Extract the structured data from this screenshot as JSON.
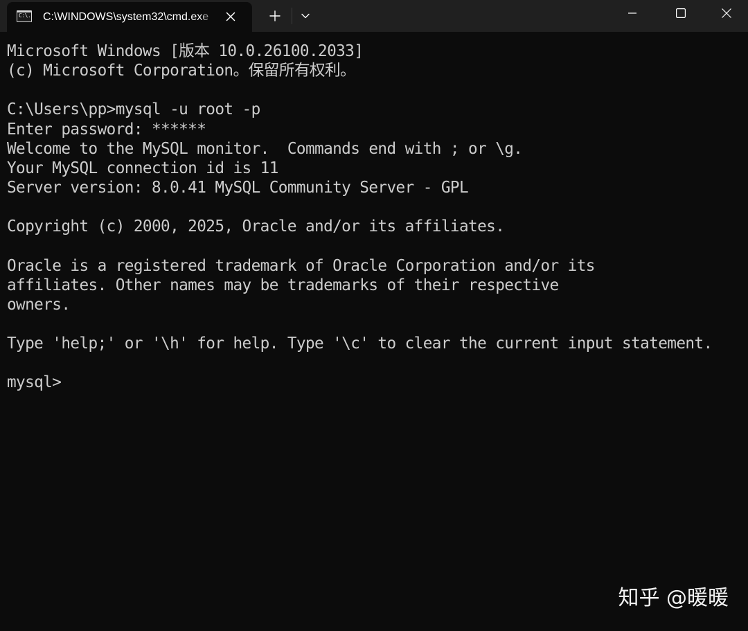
{
  "window": {
    "tab_title": "C:\\WINDOWS\\system32\\cmd.exe",
    "tab_icon_text": "C:\\."
  },
  "icons": {
    "tab": "terminal-icon",
    "close_tab": "close-icon",
    "new_tab": "plus-icon",
    "dropdown": "chevron-down-icon",
    "minimize": "minimize-icon",
    "maximize": "maximize-icon",
    "close_window": "close-icon"
  },
  "terminal": {
    "lines": [
      "Microsoft Windows [版本 10.0.26100.2033]",
      "(c) Microsoft Corporation。保留所有权利。",
      "",
      "C:\\Users\\pp>mysql -u root -p",
      "Enter password: ******",
      "Welcome to the MySQL monitor.  Commands end with ; or \\g.",
      "Your MySQL connection id is 11",
      "Server version: 8.0.41 MySQL Community Server - GPL",
      "",
      "Copyright (c) 2000, 2025, Oracle and/or its affiliates.",
      "",
      "Oracle is a registered trademark of Oracle Corporation and/or its",
      "affiliates. Other names may be trademarks of their respective",
      "owners.",
      "",
      "Type 'help;' or '\\h' for help. Type '\\c' to clear the current input statement.",
      "",
      "mysql> "
    ]
  },
  "watermark": {
    "text": "知乎 @暖暖"
  },
  "colors": {
    "titlebar": "#202020",
    "tab": "#0c0c0c",
    "terminal_bg": "#0c0c0c",
    "terminal_text": "#cccccc"
  }
}
